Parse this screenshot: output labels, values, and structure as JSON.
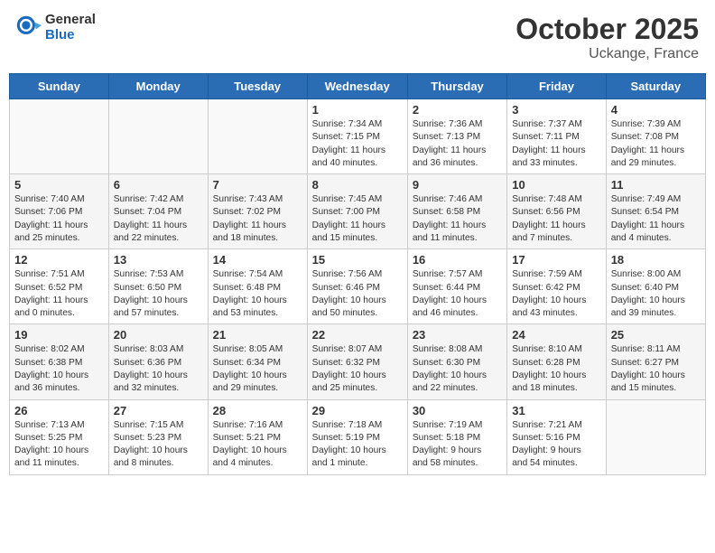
{
  "header": {
    "logo_general": "General",
    "logo_blue": "Blue",
    "month": "October 2025",
    "location": "Uckange, France"
  },
  "days_of_week": [
    "Sunday",
    "Monday",
    "Tuesday",
    "Wednesday",
    "Thursday",
    "Friday",
    "Saturday"
  ],
  "weeks": [
    [
      {
        "day": "",
        "info": ""
      },
      {
        "day": "",
        "info": ""
      },
      {
        "day": "",
        "info": ""
      },
      {
        "day": "1",
        "info": "Sunrise: 7:34 AM\nSunset: 7:15 PM\nDaylight: 11 hours\nand 40 minutes."
      },
      {
        "day": "2",
        "info": "Sunrise: 7:36 AM\nSunset: 7:13 PM\nDaylight: 11 hours\nand 36 minutes."
      },
      {
        "day": "3",
        "info": "Sunrise: 7:37 AM\nSunset: 7:11 PM\nDaylight: 11 hours\nand 33 minutes."
      },
      {
        "day": "4",
        "info": "Sunrise: 7:39 AM\nSunset: 7:08 PM\nDaylight: 11 hours\nand 29 minutes."
      }
    ],
    [
      {
        "day": "5",
        "info": "Sunrise: 7:40 AM\nSunset: 7:06 PM\nDaylight: 11 hours\nand 25 minutes."
      },
      {
        "day": "6",
        "info": "Sunrise: 7:42 AM\nSunset: 7:04 PM\nDaylight: 11 hours\nand 22 minutes."
      },
      {
        "day": "7",
        "info": "Sunrise: 7:43 AM\nSunset: 7:02 PM\nDaylight: 11 hours\nand 18 minutes."
      },
      {
        "day": "8",
        "info": "Sunrise: 7:45 AM\nSunset: 7:00 PM\nDaylight: 11 hours\nand 15 minutes."
      },
      {
        "day": "9",
        "info": "Sunrise: 7:46 AM\nSunset: 6:58 PM\nDaylight: 11 hours\nand 11 minutes."
      },
      {
        "day": "10",
        "info": "Sunrise: 7:48 AM\nSunset: 6:56 PM\nDaylight: 11 hours\nand 7 minutes."
      },
      {
        "day": "11",
        "info": "Sunrise: 7:49 AM\nSunset: 6:54 PM\nDaylight: 11 hours\nand 4 minutes."
      }
    ],
    [
      {
        "day": "12",
        "info": "Sunrise: 7:51 AM\nSunset: 6:52 PM\nDaylight: 11 hours\nand 0 minutes."
      },
      {
        "day": "13",
        "info": "Sunrise: 7:53 AM\nSunset: 6:50 PM\nDaylight: 10 hours\nand 57 minutes."
      },
      {
        "day": "14",
        "info": "Sunrise: 7:54 AM\nSunset: 6:48 PM\nDaylight: 10 hours\nand 53 minutes."
      },
      {
        "day": "15",
        "info": "Sunrise: 7:56 AM\nSunset: 6:46 PM\nDaylight: 10 hours\nand 50 minutes."
      },
      {
        "day": "16",
        "info": "Sunrise: 7:57 AM\nSunset: 6:44 PM\nDaylight: 10 hours\nand 46 minutes."
      },
      {
        "day": "17",
        "info": "Sunrise: 7:59 AM\nSunset: 6:42 PM\nDaylight: 10 hours\nand 43 minutes."
      },
      {
        "day": "18",
        "info": "Sunrise: 8:00 AM\nSunset: 6:40 PM\nDaylight: 10 hours\nand 39 minutes."
      }
    ],
    [
      {
        "day": "19",
        "info": "Sunrise: 8:02 AM\nSunset: 6:38 PM\nDaylight: 10 hours\nand 36 minutes."
      },
      {
        "day": "20",
        "info": "Sunrise: 8:03 AM\nSunset: 6:36 PM\nDaylight: 10 hours\nand 32 minutes."
      },
      {
        "day": "21",
        "info": "Sunrise: 8:05 AM\nSunset: 6:34 PM\nDaylight: 10 hours\nand 29 minutes."
      },
      {
        "day": "22",
        "info": "Sunrise: 8:07 AM\nSunset: 6:32 PM\nDaylight: 10 hours\nand 25 minutes."
      },
      {
        "day": "23",
        "info": "Sunrise: 8:08 AM\nSunset: 6:30 PM\nDaylight: 10 hours\nand 22 minutes."
      },
      {
        "day": "24",
        "info": "Sunrise: 8:10 AM\nSunset: 6:28 PM\nDaylight: 10 hours\nand 18 minutes."
      },
      {
        "day": "25",
        "info": "Sunrise: 8:11 AM\nSunset: 6:27 PM\nDaylight: 10 hours\nand 15 minutes."
      }
    ],
    [
      {
        "day": "26",
        "info": "Sunrise: 7:13 AM\nSunset: 5:25 PM\nDaylight: 10 hours\nand 11 minutes."
      },
      {
        "day": "27",
        "info": "Sunrise: 7:15 AM\nSunset: 5:23 PM\nDaylight: 10 hours\nand 8 minutes."
      },
      {
        "day": "28",
        "info": "Sunrise: 7:16 AM\nSunset: 5:21 PM\nDaylight: 10 hours\nand 4 minutes."
      },
      {
        "day": "29",
        "info": "Sunrise: 7:18 AM\nSunset: 5:19 PM\nDaylight: 10 hours\nand 1 minute."
      },
      {
        "day": "30",
        "info": "Sunrise: 7:19 AM\nSunset: 5:18 PM\nDaylight: 9 hours\nand 58 minutes."
      },
      {
        "day": "31",
        "info": "Sunrise: 7:21 AM\nSunset: 5:16 PM\nDaylight: 9 hours\nand 54 minutes."
      },
      {
        "day": "",
        "info": ""
      }
    ]
  ]
}
